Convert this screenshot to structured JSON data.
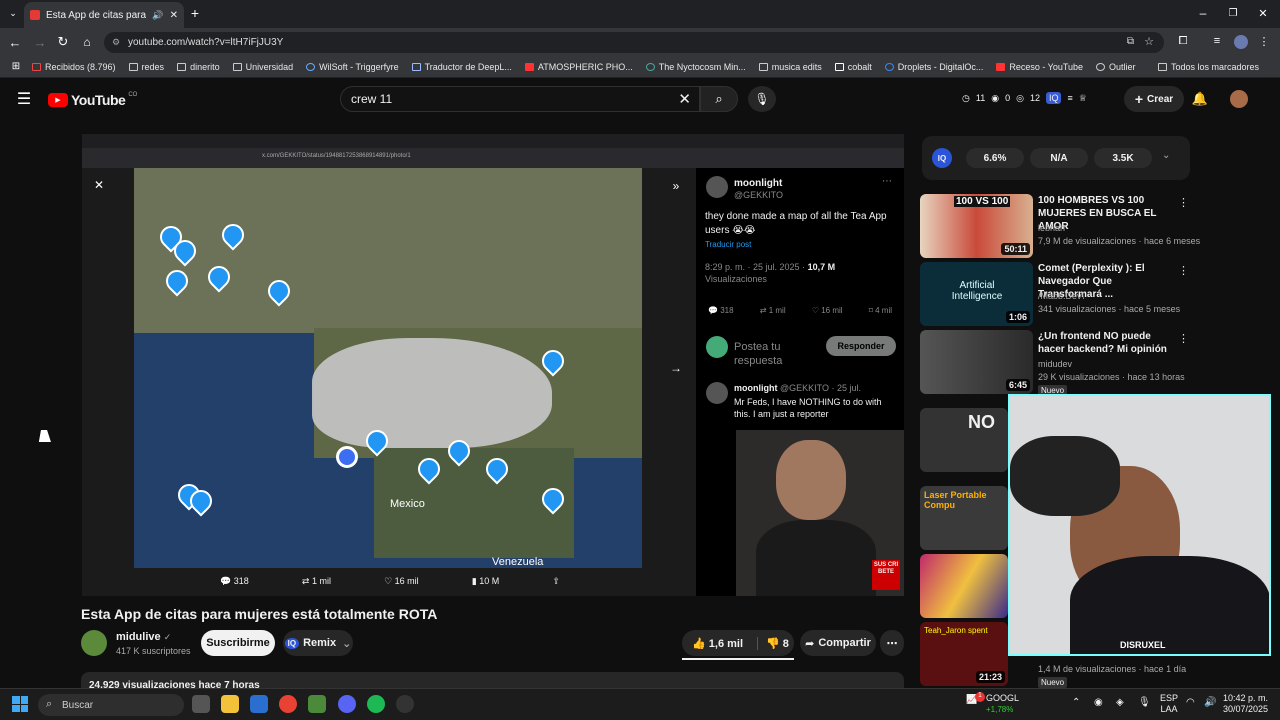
{
  "browser": {
    "tab_title": "Esta App de citas para mujeres",
    "url": "youtube.com/watch?v=ltH7iFjJU3Y",
    "bookmarks": [
      "Recibidos (8.796)",
      "redes",
      "dinerito",
      "Universidad",
      "WilSoft - Triggerfyre",
      "Traductor de DeepL...",
      "ATMOSPHERIC PHO...",
      "The Nyctocosm Min...",
      "musica edits",
      "cobalt",
      "Droplets - DigitalOc...",
      "Receso - YouTube",
      "Outlier"
    ],
    "all_bookmarks": "Todos los marcadores"
  },
  "yt": {
    "logo": "YouTube",
    "logo_sup": "CO",
    "search_value": "crew 11",
    "stats": [
      "11",
      "0",
      "12"
    ],
    "create": "Crear"
  },
  "video": {
    "inner_url": "x.com/GEKKITO/status/1948817253868914891/photo/1",
    "map_labels": [
      "Mexico",
      "Venezuela"
    ],
    "tweet": {
      "name": "moonlight",
      "handle": "@GEKKITO",
      "text": "they done made a map of all the Tea App users 😭😭",
      "translate": "Traducir post",
      "time": "8:29 p. m. · 25 jul. 2025 ·",
      "views_num": "10,7 M",
      "views_label": "Visualizaciones",
      "actions": [
        "318",
        "1 mil",
        "16 mil",
        "4 mil"
      ],
      "reply_placeholder": "Postea tu respuesta",
      "reply_btn": "Responder",
      "reply2_head": "moonlight",
      "reply2_handle": "@GEKKITO · 25 jul.",
      "reply2_text": "Mr Feds, I have NOTHING to do with this. I am just a reporter"
    },
    "bottom_actions": [
      "318",
      "1 mil",
      "16 mil",
      "10 M"
    ],
    "sub_badge": "SUS CRI BETE",
    "cam2_label": "DISRUXEL",
    "title": "Esta App de citas para mujeres está totalmente ROTA",
    "channel": "midulive",
    "subs": "417 K suscriptores",
    "subscribe": "Suscribirme",
    "remix": "Remix",
    "likes": "1,6 mil",
    "dislikes": "8",
    "share": "Compartir",
    "views_row": "24.929 visualizaciones hace 7 horas"
  },
  "iq": {
    "label": "IQ",
    "pills": [
      "6.6%",
      "N/A",
      "3.5K"
    ]
  },
  "related": [
    {
      "title": "100 HOMBRES VS 100 MUJERES EN BUSCA EL AMOR",
      "channel": "lebriah",
      "meta": "7,9 M de visualizaciones · hace 6 meses",
      "dur": "50:11",
      "thumb_text": "100 VS 100",
      "badge": ""
    },
    {
      "title": "Comet (Perplexity ): El Navegador Que Transformará ...",
      "channel": "/Mabb.Dev\\",
      "meta": "341 visualizaciones · hace 5 meses",
      "dur": "1:06",
      "thumb_text": "Artificial Intelligence",
      "badge": ""
    },
    {
      "title": "¿Un frontend NO puede hacer backend? Mi opinión",
      "channel": "midudev",
      "meta": "29 K visualizaciones · hace 13 horas",
      "dur": "6:45",
      "thumb_text": "",
      "badge": "Nuevo"
    },
    {
      "title": "",
      "channel": "",
      "meta": "",
      "dur": "",
      "thumb_text": "NO",
      "badge": ""
    },
    {
      "title": "",
      "channel": "",
      "meta": "",
      "dur": "",
      "thumb_text": "Laser Portable Compu",
      "badge": ""
    },
    {
      "title": "",
      "channel": "",
      "meta": "",
      "dur": "",
      "thumb_text": "",
      "badge": ""
    },
    {
      "title": "",
      "channel": "",
      "meta": "1,4 M de visualizaciones · hace 1 día",
      "dur": "21:23",
      "thumb_text": "Teah_Jaron spent",
      "badge": "Nuevo"
    }
  ],
  "taskbar": {
    "search": "Buscar",
    "stock": "GOOGL",
    "stock_change": "+1,78%",
    "lang1": "ESP",
    "lang2": "LAA",
    "time": "10:42 p. m.",
    "date": "30/07/2025",
    "badge": "1"
  }
}
